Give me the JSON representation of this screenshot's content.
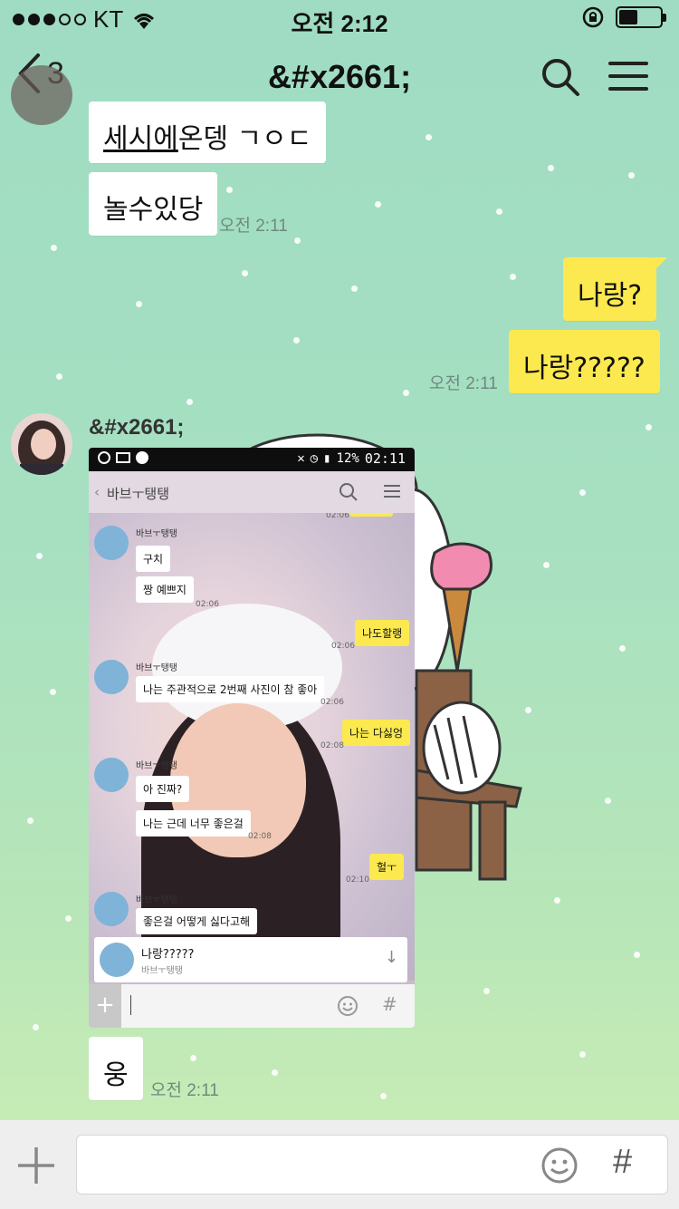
{
  "status_bar": {
    "carrier": "KT",
    "time": "오전 2:12"
  },
  "nav": {
    "back_count": "3",
    "title": "&#x2661;"
  },
  "messages": {
    "m1": "세시에온뎅 ㄱㅇㄷ",
    "m1_underlined": "세시에",
    "m1_rest": "온뎅 ㄱㅇㄷ",
    "m2": "놀수있당",
    "m2_time": "오전 2:11",
    "m3": "나랑?",
    "m4": "나랑?????",
    "m4_time": "오전 2:11",
    "sender": "&#x2661;",
    "m6": "웅",
    "m6_time": "오전 2:11"
  },
  "screenshot": {
    "status_time": "02:11",
    "battery": "12%",
    "chat_title": "바브ㅜ탱탱",
    "items": [
      {
        "kind": "time",
        "text": "02:06"
      },
      {
        "kind": "name",
        "text": "바브ㅜ탱탱"
      },
      {
        "kind": "them",
        "text": "구치"
      },
      {
        "kind": "them",
        "text": "짱 예쁘지"
      },
      {
        "kind": "time",
        "text": "02:06"
      },
      {
        "kind": "me",
        "text": "나도할랭"
      },
      {
        "kind": "time",
        "text": "02:06"
      },
      {
        "kind": "name",
        "text": "바브ㅜ탱탱"
      },
      {
        "kind": "them",
        "text": "나는 주관적으로 2번째 사진이 참 좋아"
      },
      {
        "kind": "time",
        "text": "02:06"
      },
      {
        "kind": "me",
        "text": "나는 다싫엉"
      },
      {
        "kind": "time",
        "text": "02:08"
      },
      {
        "kind": "name",
        "text": "바브ㅜ탱탱"
      },
      {
        "kind": "them",
        "text": "아 진짜?"
      },
      {
        "kind": "them",
        "text": "나는 근데 너무 좋은걸"
      },
      {
        "kind": "time",
        "text": "02:08"
      },
      {
        "kind": "me",
        "text": "헐ㅜ"
      },
      {
        "kind": "time",
        "text": "02:10"
      },
      {
        "kind": "name",
        "text": "바브ㅜ탱탱"
      },
      {
        "kind": "them",
        "text": "좋은걸 어떻게 싫다고해"
      }
    ],
    "notice_text": "나랑?????",
    "notice_sub": "바브ㅜ탱탱",
    "input_hash": "#"
  },
  "input_bar": {
    "hash": "#"
  },
  "colors": {
    "my_bubble": "#fbe94f",
    "their_bubble": "#ffffff",
    "background_top": "#9fdcc3",
    "background_bottom": "#cdeeb4"
  },
  "icons": {
    "signal": "signal-dots-icon",
    "wifi": "wifi-icon",
    "lock": "rotation-lock-icon",
    "battery": "battery-icon",
    "back": "chevron-left-icon",
    "search": "search-icon",
    "menu": "hamburger-menu-icon",
    "plus": "plus-icon",
    "emoji": "emoji-icon"
  }
}
